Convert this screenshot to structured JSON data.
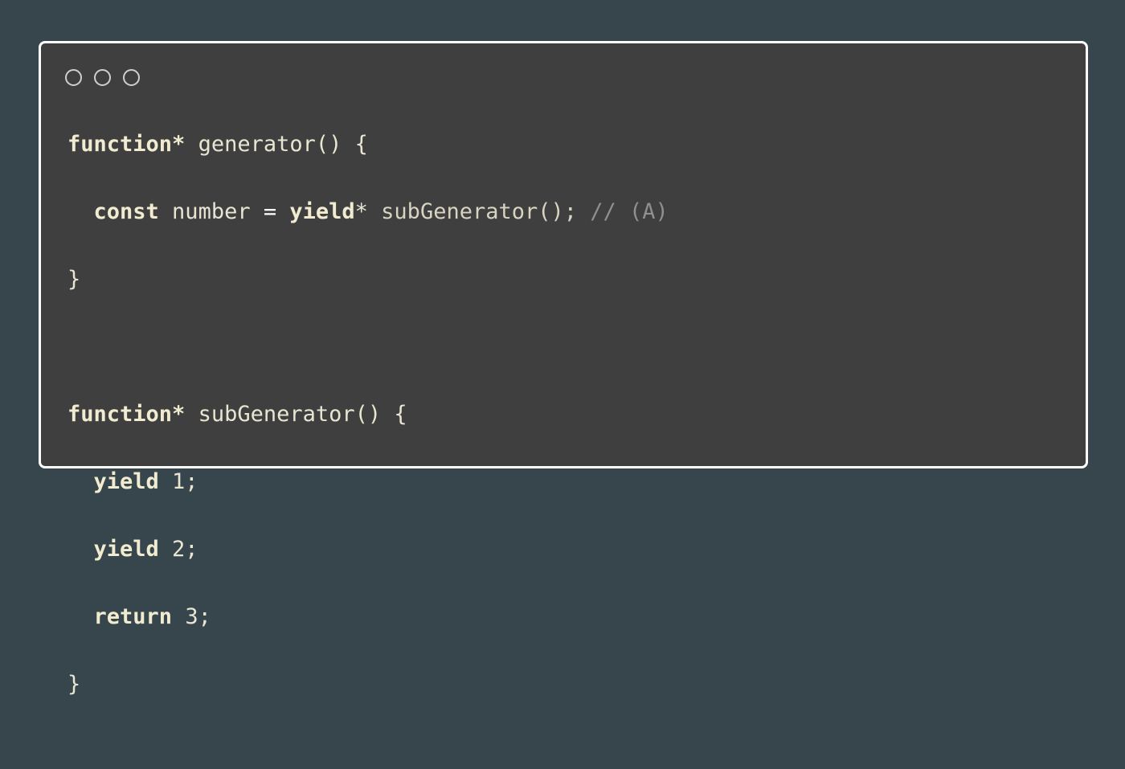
{
  "window": {
    "controls": [
      "close",
      "minimize",
      "maximize"
    ]
  },
  "code": {
    "lines": [
      {
        "tokens": [
          {
            "text": "function*",
            "type": "keyword"
          },
          {
            "text": " generator() {",
            "type": "plain"
          }
        ]
      },
      {
        "tokens": [
          {
            "text": "  ",
            "type": "plain"
          },
          {
            "text": "const",
            "type": "keyword"
          },
          {
            "text": " number ",
            "type": "plain"
          },
          {
            "text": "=",
            "type": "operator"
          },
          {
            "text": " ",
            "type": "plain"
          },
          {
            "text": "yield",
            "type": "keyword"
          },
          {
            "text": "* ",
            "type": "plain"
          },
          {
            "text": "subGenerator();",
            "type": "call"
          },
          {
            "text": " // (A)",
            "type": "comment"
          }
        ]
      },
      {
        "tokens": [
          {
            "text": "}",
            "type": "plain"
          }
        ]
      },
      {
        "tokens": [
          {
            "text": " ",
            "type": "plain"
          }
        ]
      },
      {
        "tokens": [
          {
            "text": "function*",
            "type": "keyword"
          },
          {
            "text": " subGenerator() {",
            "type": "plain"
          }
        ]
      },
      {
        "tokens": [
          {
            "text": "  ",
            "type": "plain"
          },
          {
            "text": "yield",
            "type": "keyword"
          },
          {
            "text": " 1;",
            "type": "plain"
          }
        ]
      },
      {
        "tokens": [
          {
            "text": "  ",
            "type": "plain"
          },
          {
            "text": "yield",
            "type": "keyword"
          },
          {
            "text": " 2;",
            "type": "plain"
          }
        ]
      },
      {
        "tokens": [
          {
            "text": "  ",
            "type": "plain"
          },
          {
            "text": "return",
            "type": "keyword"
          },
          {
            "text": " 3;",
            "type": "plain"
          }
        ]
      },
      {
        "tokens": [
          {
            "text": "}",
            "type": "plain"
          }
        ]
      }
    ]
  },
  "colors": {
    "background": "#37464d",
    "window": "#3f3f3f",
    "window_border": "#ffffff",
    "keyword": "#f1ebcf",
    "text": "#e9e5d3",
    "comment": "#8f8f8f"
  }
}
